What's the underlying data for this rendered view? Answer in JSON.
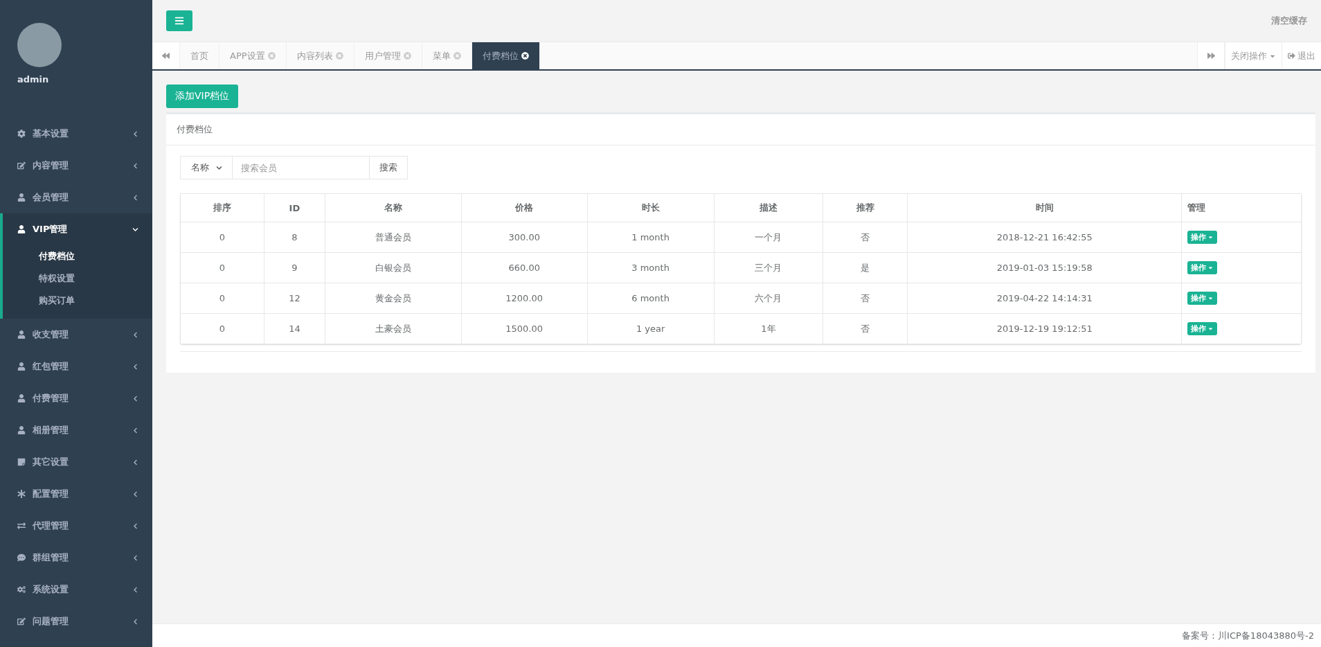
{
  "user": {
    "name": "admin"
  },
  "sidebar": {
    "items": [
      {
        "label": "基本设置",
        "expanded": false
      },
      {
        "label": "内容管理",
        "expanded": false
      },
      {
        "label": "会员管理",
        "expanded": false
      },
      {
        "label": "VIP管理",
        "expanded": true,
        "children": [
          {
            "label": "付费档位",
            "selected": true
          },
          {
            "label": "特权设置",
            "selected": false
          },
          {
            "label": "购买订单",
            "selected": false
          }
        ]
      },
      {
        "label": "收支管理",
        "expanded": false
      },
      {
        "label": "红包管理",
        "expanded": false
      },
      {
        "label": "付费管理",
        "expanded": false
      },
      {
        "label": "相册管理",
        "expanded": false
      },
      {
        "label": "其它设置",
        "expanded": false
      },
      {
        "label": "配置管理",
        "expanded": false
      },
      {
        "label": "代理管理",
        "expanded": false
      },
      {
        "label": "群组管理",
        "expanded": false
      },
      {
        "label": "系统设置",
        "expanded": false
      },
      {
        "label": "问题管理",
        "expanded": false
      }
    ]
  },
  "topbar": {
    "clear_cache": "清空缓存"
  },
  "tabs": [
    {
      "label": "首页",
      "closable": false,
      "selected": false
    },
    {
      "label": "APP设置",
      "closable": true,
      "selected": false
    },
    {
      "label": "内容列表",
      "closable": true,
      "selected": false
    },
    {
      "label": "用户管理",
      "closable": true,
      "selected": false
    },
    {
      "label": "菜单",
      "closable": true,
      "selected": false
    },
    {
      "label": "付费档位",
      "closable": true,
      "selected": true
    }
  ],
  "tab_actions": {
    "close_ops": "关闭操作",
    "logout": "退出"
  },
  "add_button": "添加VIP档位",
  "panel": {
    "title": "付费档位",
    "search": {
      "field": "名称",
      "placeholder": "搜索会员",
      "button": "搜索"
    },
    "table": {
      "columns": [
        "排序",
        "ID",
        "名称",
        "价格",
        "时长",
        "描述",
        "推荐",
        "时间",
        "管理"
      ],
      "rows": [
        {
          "cells": [
            "0",
            "8",
            "普通会员",
            "300.00",
            "1 month",
            "一个月",
            "否",
            "2018-12-21 16:42:55"
          ],
          "action": "操作"
        },
        {
          "cells": [
            "0",
            "9",
            "白银会员",
            "660.00",
            "3 month",
            "三个月",
            "是",
            "2019-01-03 15:19:58"
          ],
          "action": "操作"
        },
        {
          "cells": [
            "0",
            "12",
            "黄金会员",
            "1200.00",
            "6 month",
            "六个月",
            "否",
            "2019-04-22 14:14:31"
          ],
          "action": "操作"
        },
        {
          "cells": [
            "0",
            "14",
            "土豪会员",
            "1500.00",
            "1 year",
            "1年",
            "否",
            "2019-12-19 19:12:51"
          ],
          "action": "操作"
        }
      ]
    }
  },
  "footer": "备案号：川ICP备18043880号-2"
}
